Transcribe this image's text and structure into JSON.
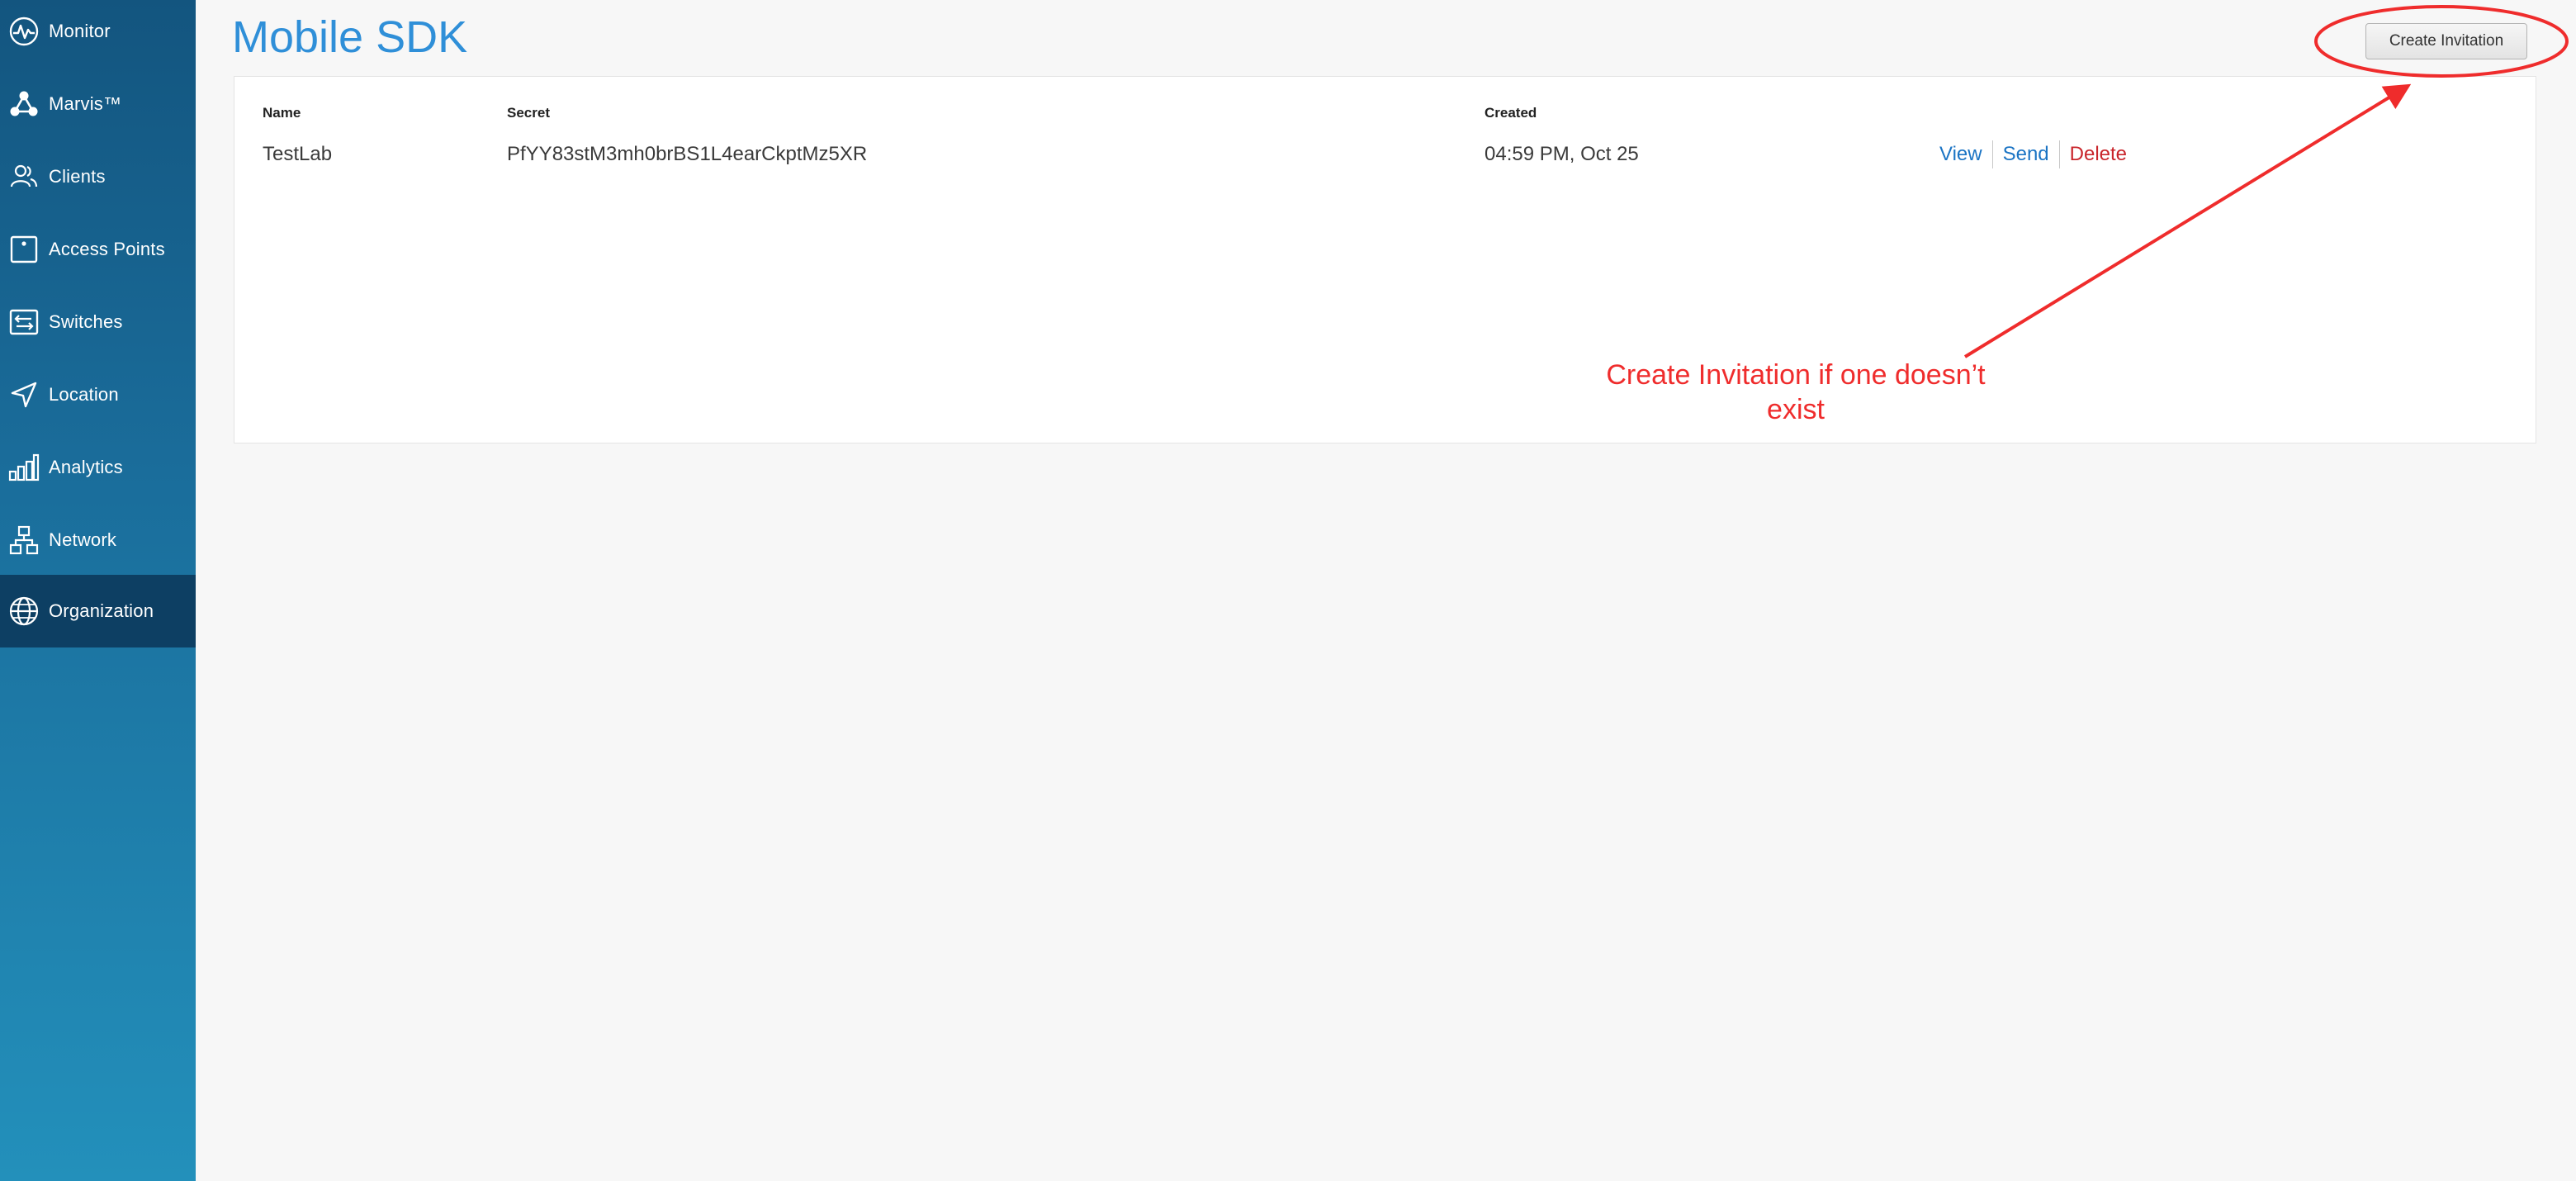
{
  "sidebar": {
    "items": [
      {
        "label": "Monitor",
        "icon": "monitor-icon"
      },
      {
        "label": "Marvis™",
        "icon": "marvis-icon"
      },
      {
        "label": "Clients",
        "icon": "clients-icon"
      },
      {
        "label": "Access Points",
        "icon": "access-point-icon"
      },
      {
        "label": "Switches",
        "icon": "switch-icon"
      },
      {
        "label": "Location",
        "icon": "location-arrow-icon"
      },
      {
        "label": "Analytics",
        "icon": "bar-chart-icon"
      },
      {
        "label": "Network",
        "icon": "network-icon"
      },
      {
        "label": "Organization",
        "icon": "globe-icon",
        "active": true
      }
    ]
  },
  "page": {
    "title": "Mobile SDK",
    "create_button_label": "Create Invitation"
  },
  "table": {
    "headers": {
      "name": "Name",
      "secret": "Secret",
      "created": "Created"
    },
    "rows": [
      {
        "name": "TestLab",
        "secret": "PfYY83stM3mh0brBS1L4earCkptMz5XR",
        "created": "04:59 PM, Oct 25",
        "actions": {
          "view": "View",
          "send": "Send",
          "delete": "Delete"
        }
      }
    ]
  },
  "annotation": {
    "line1": "Create Invitation if one doesn’t",
    "line2": "exist",
    "color": "#ef2c2c"
  },
  "colors": {
    "title_blue": "#2f8fd8",
    "link_blue": "#1b74c4",
    "delete_red": "#c9252b",
    "sidebar_active": "#0d3f63"
  }
}
